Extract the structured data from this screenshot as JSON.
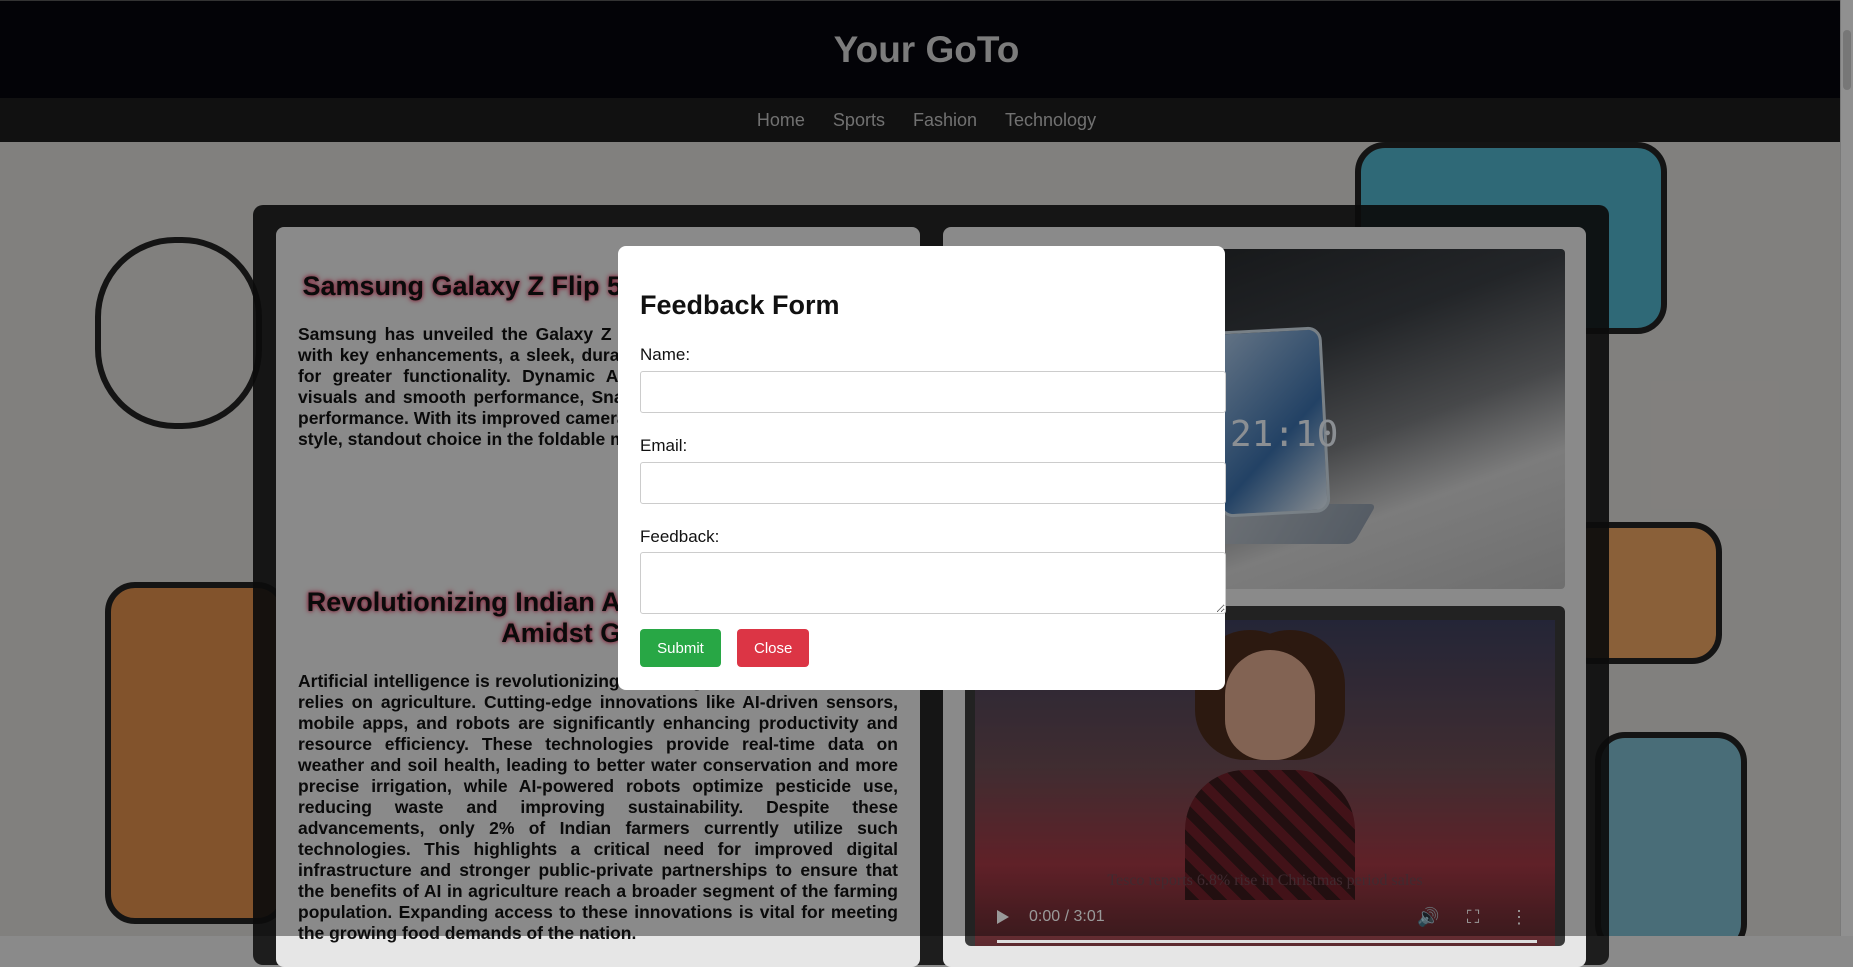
{
  "header": {
    "title": "Your GoTo"
  },
  "nav": {
    "items": [
      "Home",
      "Sports",
      "Fashion",
      "Technology"
    ]
  },
  "articles": [
    {
      "title": "Samsung Galaxy Z Flip 5: Foldable Innovation",
      "body": "Samsung has unveiled the Galaxy Z Flip 5, a smartphone experience with key enhancements, a sleek, durable design with a refined display for greater functionality. Dynamic AMOLED 2X screen with vibrant visuals and smooth performance, Snapdragon 8 Gen 2 processor, the performance. With its improved camera, latest foldable phone combines style, standout choice in the foldable market."
    },
    {
      "title": "Revolutionizing Indian Agriculture: Efficiency Amidst Growth",
      "body": "Artificial intelligence is revolutionizing Indian agriculture, the workforce relies on agriculture. Cutting-edge innovations like AI-driven sensors, mobile apps, and robots are significantly enhancing productivity and resource efficiency. These technologies provide real-time data on weather and soil health, leading to better water conservation and more precise irrigation, while AI-powered robots optimize pesticide use, reducing waste and improving sustainability. Despite these advancements, only 2% of Indian farmers currently utilize such technologies. This highlights a critical need for improved digital infrastructure and stronger public-private partnerships to ensure that the benefits of AI in agriculture reach a broader segment of the farming population. Expanding access to these innovations is vital for meeting the growing food demands of the nation."
    }
  ],
  "media": {
    "phone_clock": "21:10",
    "video_caption": "Tesco reports 6.8% rise in Christmas period sales",
    "video_time": "0:00 / 3:01"
  },
  "modal": {
    "title": "Feedback Form",
    "name_label": "Name:",
    "email_label": "Email:",
    "feedback_label": "Feedback:",
    "submit_label": "Submit",
    "close_label": "Close"
  }
}
